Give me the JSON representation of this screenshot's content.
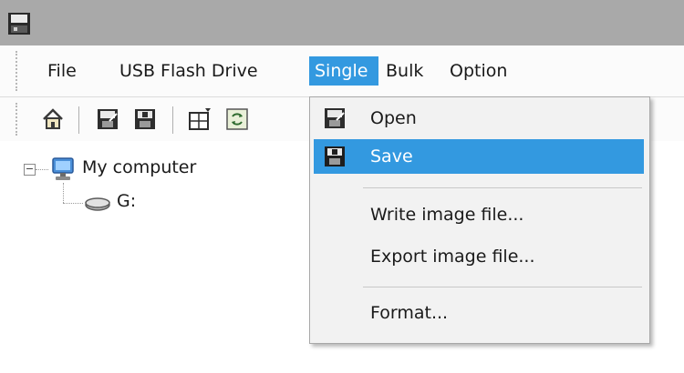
{
  "menubar": {
    "items": [
      {
        "label": "File"
      },
      {
        "label": "USB Flash Drive"
      },
      {
        "label": "Single"
      },
      {
        "label": "Bulk"
      },
      {
        "label": "Option"
      }
    ],
    "active_item": "Single"
  },
  "toolbar": {
    "buttons": [
      "home-icon",
      "open-disk-icon",
      "save-disk-icon",
      "table-icon",
      "refresh-icon"
    ]
  },
  "tree": {
    "root_label": "My computer",
    "child_label": "G:",
    "root_icon": "computer-icon",
    "child_icon": "drive-icon"
  },
  "single_menu": {
    "items": [
      {
        "label": "Open",
        "icon": "open-disk-icon"
      },
      {
        "label": "Save",
        "icon": "save-disk-icon",
        "highlighted": true
      },
      {
        "label": "Write image file..."
      },
      {
        "label": "Export image file..."
      },
      {
        "label": "Format..."
      }
    ]
  },
  "colors": {
    "titlebar": "#a9a9a9",
    "highlight": "#3399e0",
    "menu_background": "#f2f2f2"
  }
}
